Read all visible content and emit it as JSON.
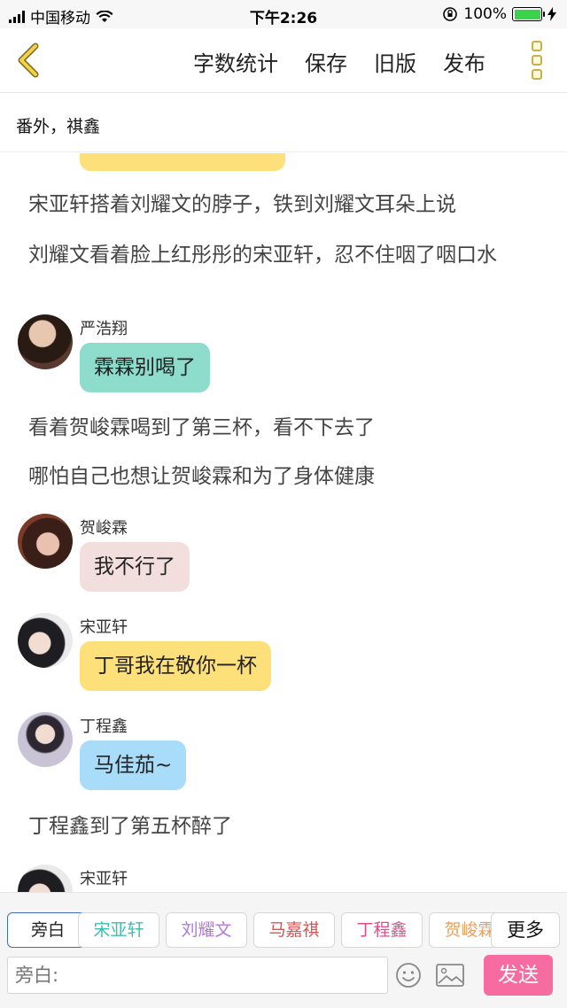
{
  "status_bar": {
    "carrier": "中国移动",
    "time": "下午2:26",
    "battery": "100%"
  },
  "nav": {
    "word_count": "字数统计",
    "save": "保存",
    "old_version": "旧版",
    "publish": "发布"
  },
  "chapter": {
    "title": "番外，祺鑫"
  },
  "colors": {
    "yellow_bubble": "#fde07a",
    "teal_bubble": "#8ddccc",
    "pink_bubble": "#f3dede",
    "blue_bubble": "#a9dcf8",
    "send": "#f76ca0"
  },
  "messages": [
    {
      "type": "partial_bubble"
    },
    {
      "type": "narration",
      "text": "宋亚轩搭着刘耀文的脖子，铁到刘耀文耳朵上说"
    },
    {
      "type": "narration",
      "text": "刘耀文看着脸上红彤彤的宋亚轩，忍不住咽了咽口水"
    },
    {
      "type": "dialog",
      "speaker": "严浩翔",
      "text": "霖霖别喝了"
    },
    {
      "type": "narration",
      "text": "看着贺峻霖喝到了第三杯，看不下去了"
    },
    {
      "type": "narration",
      "text": "哪怕自己也想让贺峻霖和为了身体健康"
    },
    {
      "type": "dialog",
      "speaker": "贺峻霖",
      "text": "我不行了"
    },
    {
      "type": "dialog",
      "speaker": "宋亚轩",
      "text": "丁哥我在敬你一杯"
    },
    {
      "type": "dialog",
      "speaker": "丁程鑫",
      "text": "马佳茄~"
    },
    {
      "type": "narration",
      "text": "丁程鑫到了第五杯醉了"
    },
    {
      "type": "dialog",
      "speaker": "宋亚轩",
      "text": ""
    }
  ],
  "roles": [
    {
      "label": "旁白",
      "color": "#222222"
    },
    {
      "label": "宋亚轩",
      "color": "#3dbfb0"
    },
    {
      "label": "刘耀文",
      "color": "#b07ad6"
    },
    {
      "label": "马嘉祺",
      "color": "#e05050"
    },
    {
      "label": "丁程鑫",
      "color": "#d9508a"
    },
    {
      "label": "贺峻霖",
      "color": "#e8a060"
    }
  ],
  "more_label": "更多",
  "input": {
    "placeholder": "旁白:"
  },
  "send_label": "发送"
}
